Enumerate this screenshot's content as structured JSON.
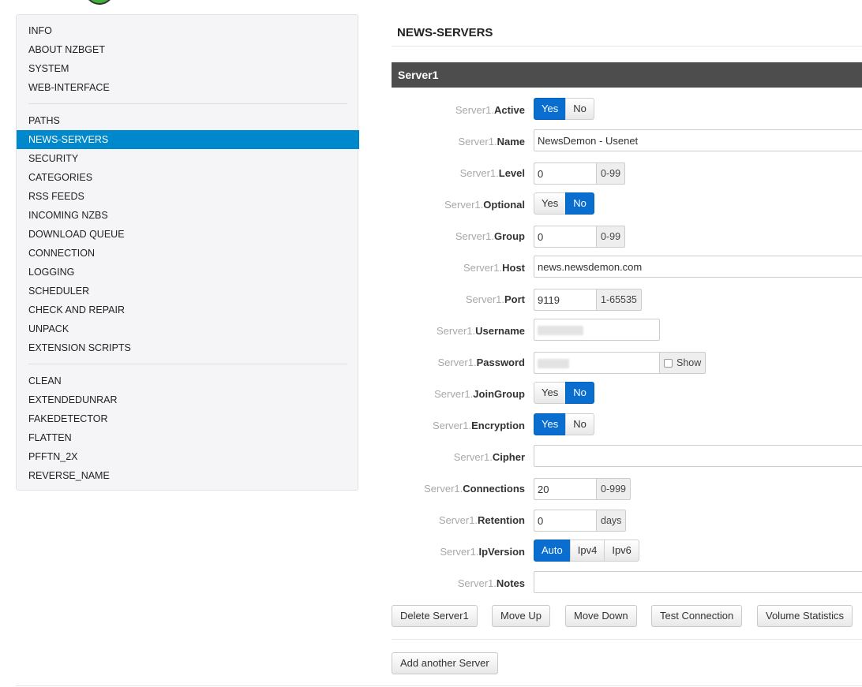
{
  "sidebar": {
    "group1": [
      "INFO",
      "ABOUT NZBGET",
      "SYSTEM",
      "WEB-INTERFACE"
    ],
    "group2": [
      "PATHS",
      "NEWS-SERVERS",
      "SECURITY",
      "CATEGORIES",
      "RSS FEEDS",
      "INCOMING NZBS",
      "DOWNLOAD QUEUE",
      "CONNECTION",
      "LOGGING",
      "SCHEDULER",
      "CHECK AND REPAIR",
      "UNPACK",
      "EXTENSION SCRIPTS"
    ],
    "group3": [
      "CLEAN",
      "EXTENDEDUNRAR",
      "FAKEDETECTOR",
      "FLATTEN",
      "PFFTN_2X",
      "REVERSE_NAME"
    ],
    "active": "NEWS-SERVERS"
  },
  "page": {
    "title": "NEWS-SERVERS",
    "section": "Server1"
  },
  "form": {
    "prefix": "Server1.",
    "active": {
      "label": "Active",
      "options": [
        "Yes",
        "No"
      ],
      "selected": "Yes"
    },
    "name": {
      "label": "Name",
      "value": "NewsDemon - Usenet"
    },
    "level": {
      "label": "Level",
      "value": "0",
      "range": "0-99"
    },
    "optional": {
      "label": "Optional",
      "options": [
        "Yes",
        "No"
      ],
      "selected": "No"
    },
    "group": {
      "label": "Group",
      "value": "0",
      "range": "0-99"
    },
    "host": {
      "label": "Host",
      "value": "news.newsdemon.com"
    },
    "port": {
      "label": "Port",
      "value": "9119",
      "range": "1-65535"
    },
    "username": {
      "label": "Username"
    },
    "password": {
      "label": "Password",
      "show_label": "Show"
    },
    "joingroup": {
      "label": "JoinGroup",
      "options": [
        "Yes",
        "No"
      ],
      "selected": "No"
    },
    "encryption": {
      "label": "Encryption",
      "options": [
        "Yes",
        "No"
      ],
      "selected": "Yes"
    },
    "cipher": {
      "label": "Cipher",
      "value": ""
    },
    "connections": {
      "label": "Connections",
      "value": "20",
      "range": "0-999"
    },
    "retention": {
      "label": "Retention",
      "value": "0",
      "unit": "days"
    },
    "ipversion": {
      "label": "IpVersion",
      "options": [
        "Auto",
        "Ipv4",
        "Ipv6"
      ],
      "selected": "Auto"
    },
    "notes": {
      "label": "Notes",
      "value": ""
    }
  },
  "actions": {
    "delete": "Delete Server1",
    "move_up": "Move Up",
    "move_down": "Move Down",
    "test": "Test Connection",
    "volume": "Volume Statistics",
    "add": "Add another Server"
  },
  "colors": {
    "accent": "#0088cc",
    "toggle_on": "#0a6ed1",
    "section_header": "#4d4d4d"
  }
}
